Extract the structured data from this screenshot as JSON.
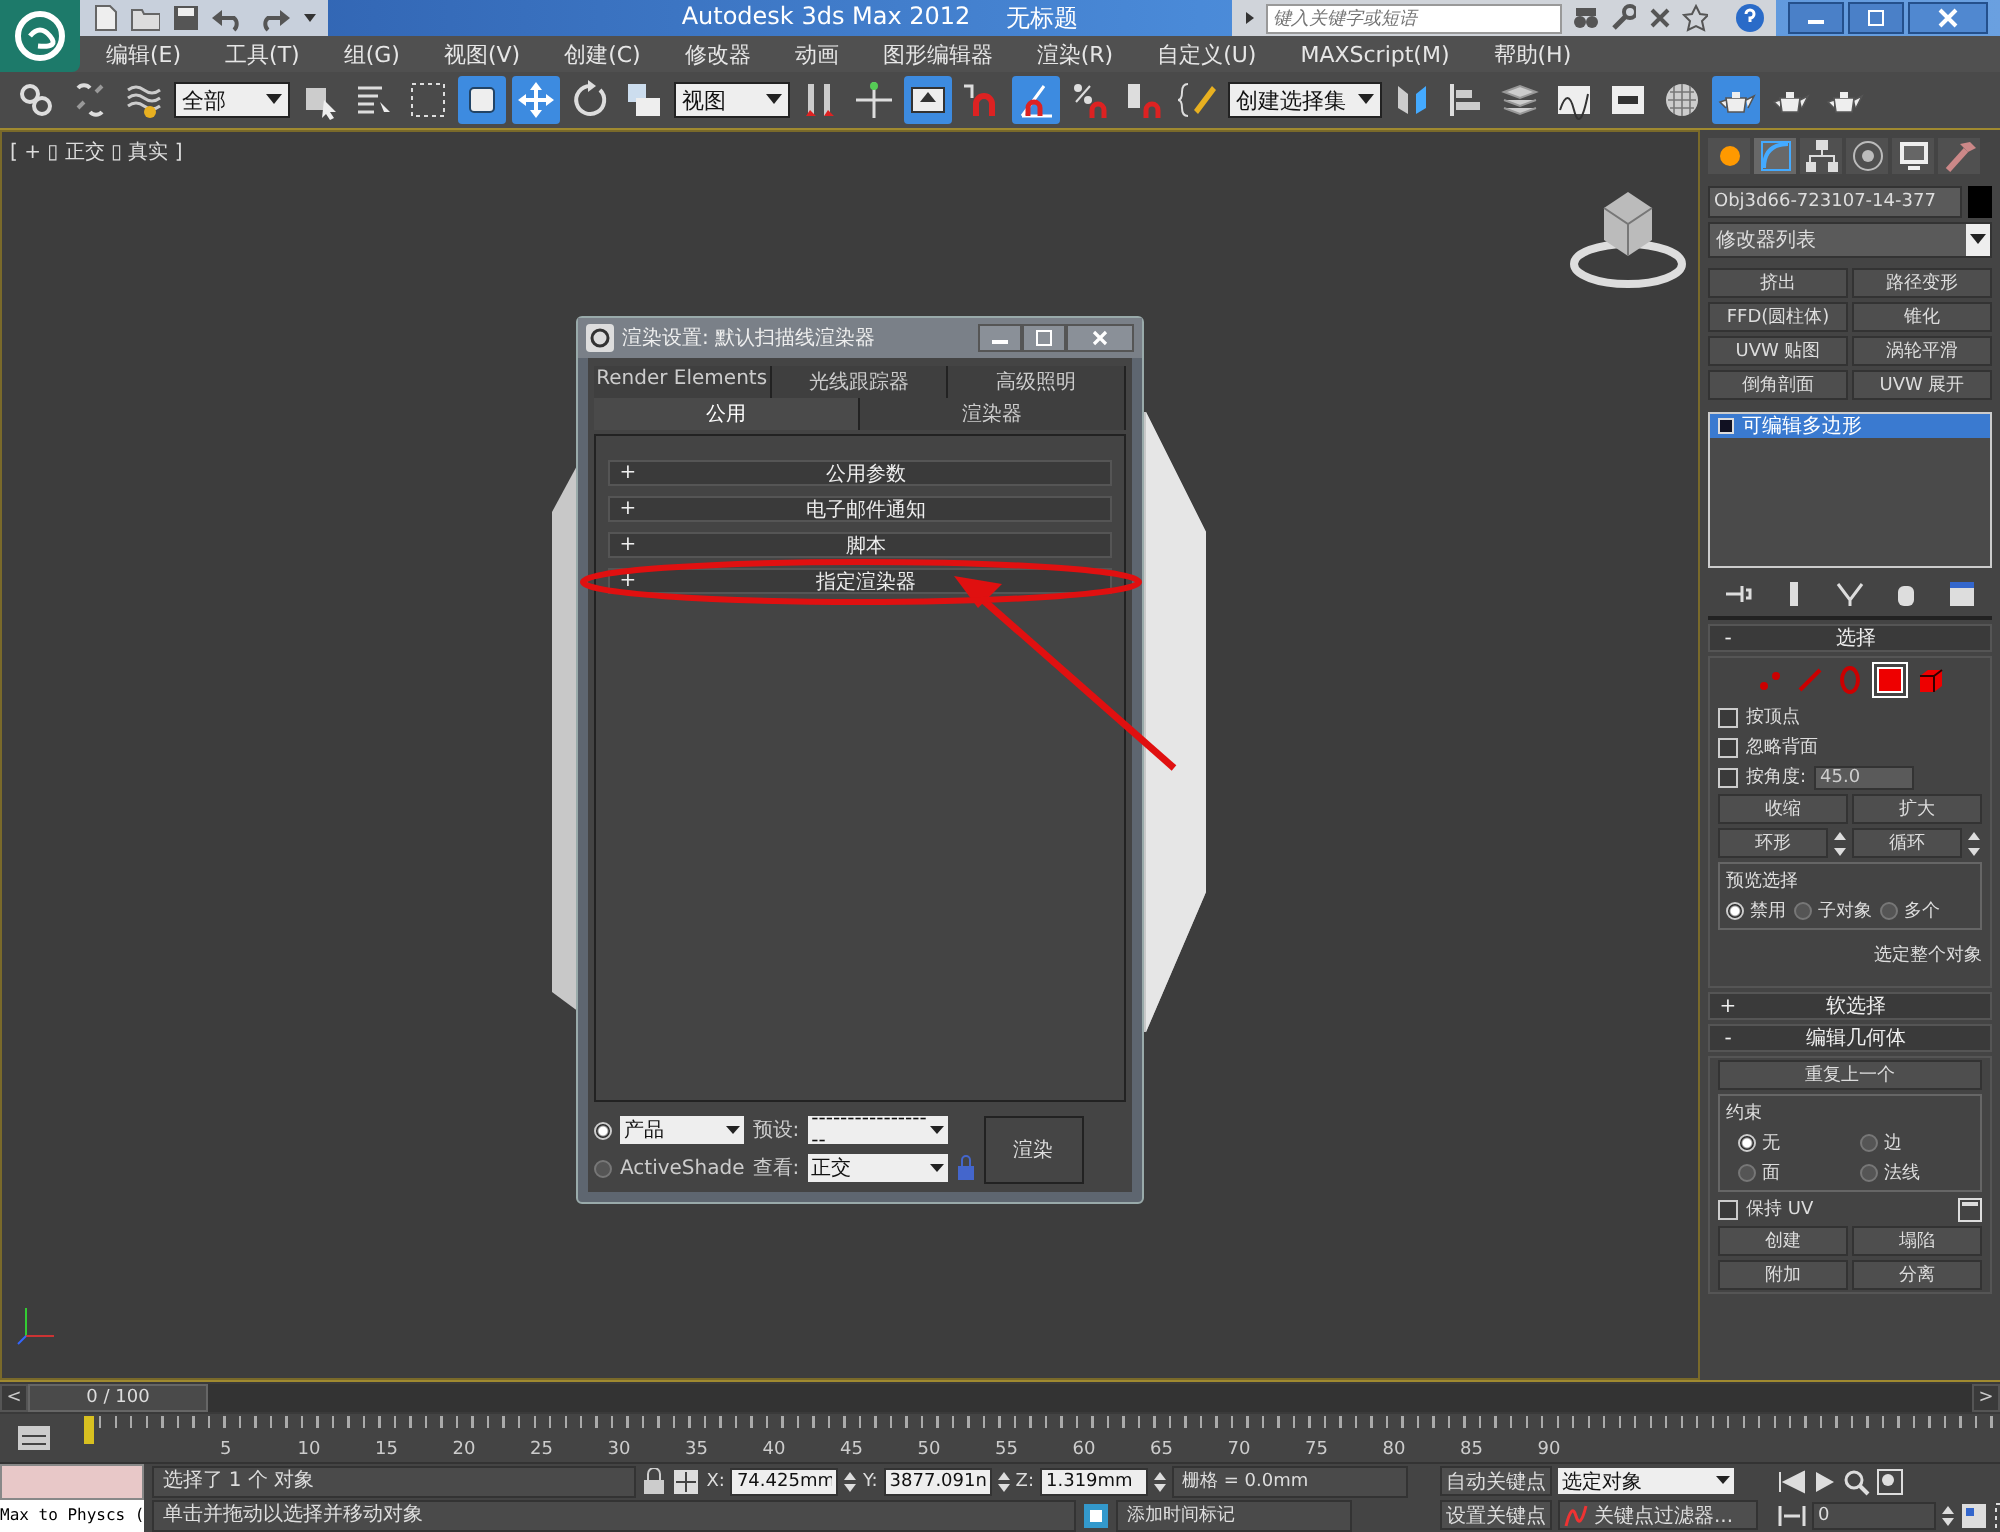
{
  "title_bar": {
    "title": "Autodesk 3ds Max  2012",
    "document": "无标题",
    "search": {
      "placeholder": "键入关键字或短语"
    }
  },
  "menu": [
    "编辑(E)",
    "工具(T)",
    "组(G)",
    "视图(V)",
    "创建(C)",
    "修改器",
    "动画",
    "图形编辑器",
    "渲染(R)",
    "自定义(U)",
    "MAXScript(M)",
    "帮助(H)"
  ],
  "toolbar": [
    {
      "kind": "link",
      "active": false
    },
    {
      "kind": "unlink",
      "active": false
    },
    {
      "kind": "bind",
      "active": false
    },
    {
      "kind": "dropdown",
      "value": "全部"
    },
    {
      "kind": "select",
      "active": false
    },
    {
      "kind": "list",
      "active": false
    },
    {
      "kind": "region",
      "active": false
    },
    {
      "kind": "crossing",
      "active": true
    },
    {
      "kind": "move",
      "active": true
    },
    {
      "kind": "rotate",
      "active": false
    },
    {
      "kind": "scale",
      "active": false
    },
    {
      "kind": "dropdown",
      "value": "视图"
    },
    {
      "kind": "pivot",
      "active": false
    },
    {
      "kind": "manipulate",
      "active": false
    },
    {
      "kind": "keyboard",
      "active": true
    },
    {
      "kind": "snap",
      "active": false
    },
    {
      "kind": "angle",
      "active": true
    },
    {
      "kind": "percent",
      "active": false
    },
    {
      "kind": "spinner",
      "active": false
    },
    {
      "kind": "abc",
      "active": false
    },
    {
      "kind": "dropdown",
      "value": "创建选择集"
    },
    {
      "kind": "mirror",
      "active": false
    },
    {
      "kind": "align",
      "active": false
    },
    {
      "kind": "layer",
      "active": false
    },
    {
      "kind": "curve",
      "active": false
    },
    {
      "kind": "schematic",
      "active": false
    },
    {
      "kind": "material",
      "active": false
    },
    {
      "kind": "teapot",
      "active": true
    },
    {
      "kind": "teapot",
      "active": false
    },
    {
      "kind": "teapot",
      "active": false
    }
  ],
  "viewport": {
    "label": "[ + ▯ 正交 ▯ 真实 ]"
  },
  "dialog": {
    "title": "渲染设置: 默认扫描线渲染器",
    "tabs_back": [
      {
        "label": "Render Elements",
        "selected": false
      },
      {
        "label": "光线跟踪器",
        "selected": false
      },
      {
        "label": "高级照明",
        "selected": false
      }
    ],
    "tabs_front": [
      {
        "label": "公用",
        "selected": true
      },
      {
        "label": "渲染器",
        "selected": false
      }
    ],
    "rollouts": [
      {
        "sign": "+",
        "label": "公用参数",
        "highlighted": false
      },
      {
        "sign": "+",
        "label": "电子邮件通知",
        "highlighted": false
      },
      {
        "sign": "+",
        "label": "脚本",
        "highlighted": false
      },
      {
        "sign": "+",
        "label": "指定渲染器",
        "highlighted": true
      }
    ],
    "modes": [
      {
        "label": "产品",
        "selected": true,
        "kind": "dropdown"
      },
      {
        "label": "ActiveShade",
        "selected": false,
        "kind": "text"
      }
    ],
    "preset_label": "预设:",
    "preset_value": "------------------",
    "view_label": "查看:",
    "view_value": "正交",
    "render_button": "渲染"
  },
  "panel": {
    "tabs": [
      {
        "kind": "create",
        "selected": false
      },
      {
        "kind": "modify",
        "selected": true
      },
      {
        "kind": "hierarchy",
        "selected": false
      },
      {
        "kind": "motion",
        "selected": false
      },
      {
        "kind": "display",
        "selected": false
      },
      {
        "kind": "utilities",
        "selected": false
      }
    ],
    "object_name": "Obj3d66-723107-14-377",
    "modifier_list": "修改器列表",
    "modifier_buttons": [
      "挤出",
      "路径变形",
      "FFD(圆柱体)",
      "锥化",
      "UVW 贴图",
      "涡轮平滑",
      "倒角剖面",
      "UVW 展开"
    ],
    "stack": [
      {
        "label": "可编辑多边形",
        "selected": true
      }
    ],
    "selection": {
      "sign": "-",
      "title": "选择",
      "levels": [
        {
          "kind": "vertex",
          "selected": false
        },
        {
          "kind": "edge",
          "selected": false
        },
        {
          "kind": "border",
          "selected": false
        },
        {
          "kind": "polygon",
          "selected": true
        },
        {
          "kind": "element",
          "selected": false
        }
      ],
      "checks": [
        {
          "label": "按顶点",
          "checked": false
        },
        {
          "label": "忽略背面",
          "checked": false
        },
        {
          "label": "按角度:",
          "checked": false
        }
      ],
      "angle": "45.0",
      "buttons": [
        "收缩",
        "扩大"
      ],
      "spin_buttons": [
        "环形",
        "循环"
      ],
      "preview_title": "预览选择",
      "preview_options": [
        {
          "label": "禁用",
          "selected": true
        },
        {
          "label": "子对象",
          "selected": false
        },
        {
          "label": "多个",
          "selected": false
        }
      ],
      "info": "选定整个对象"
    },
    "soft_selection": {
      "sign": "+",
      "title": "软选择"
    },
    "edit_geometry": {
      "sign": "-",
      "title": "编辑几何体",
      "repeat": "重复上一个",
      "constraints_title": "约束",
      "constraints": [
        {
          "label": "无",
          "selected": true
        },
        {
          "label": "边",
          "selected": false
        },
        {
          "label": "面",
          "selected": false
        },
        {
          "label": "法线",
          "selected": false
        }
      ],
      "preserve_uv": {
        "label": "保持 UV",
        "checked": false
      },
      "buttons": [
        [
          "创建",
          "塌陷"
        ],
        [
          "附加",
          "分离"
        ]
      ]
    }
  },
  "timeline": {
    "prev": "<",
    "frame": "0 / 100",
    "next": ">",
    "ruler_labels": [
      "5",
      "10",
      "15",
      "20",
      "25",
      "30",
      "35",
      "40",
      "45",
      "50",
      "55",
      "60",
      "65",
      "70",
      "75",
      "80",
      "85",
      "90"
    ]
  },
  "status": {
    "script_listener": "Max to Physcs (",
    "selection": "选择了 1 个 对象",
    "prompt": "单击并拖动以选择并移动对象",
    "x_label": "X:",
    "x": "74.425mm",
    "y_label": "Y:",
    "y": "3877.091n",
    "z_label": "Z:",
    "z": "1.319mm",
    "grid": "栅格 = 0.0mm",
    "add_time_tag": "添加时间标记",
    "auto_key": "自动关键点",
    "set_key": "设置关键点",
    "key_mode": "选定对象",
    "key_filters": "关键点过滤器...",
    "frame": "0"
  }
}
